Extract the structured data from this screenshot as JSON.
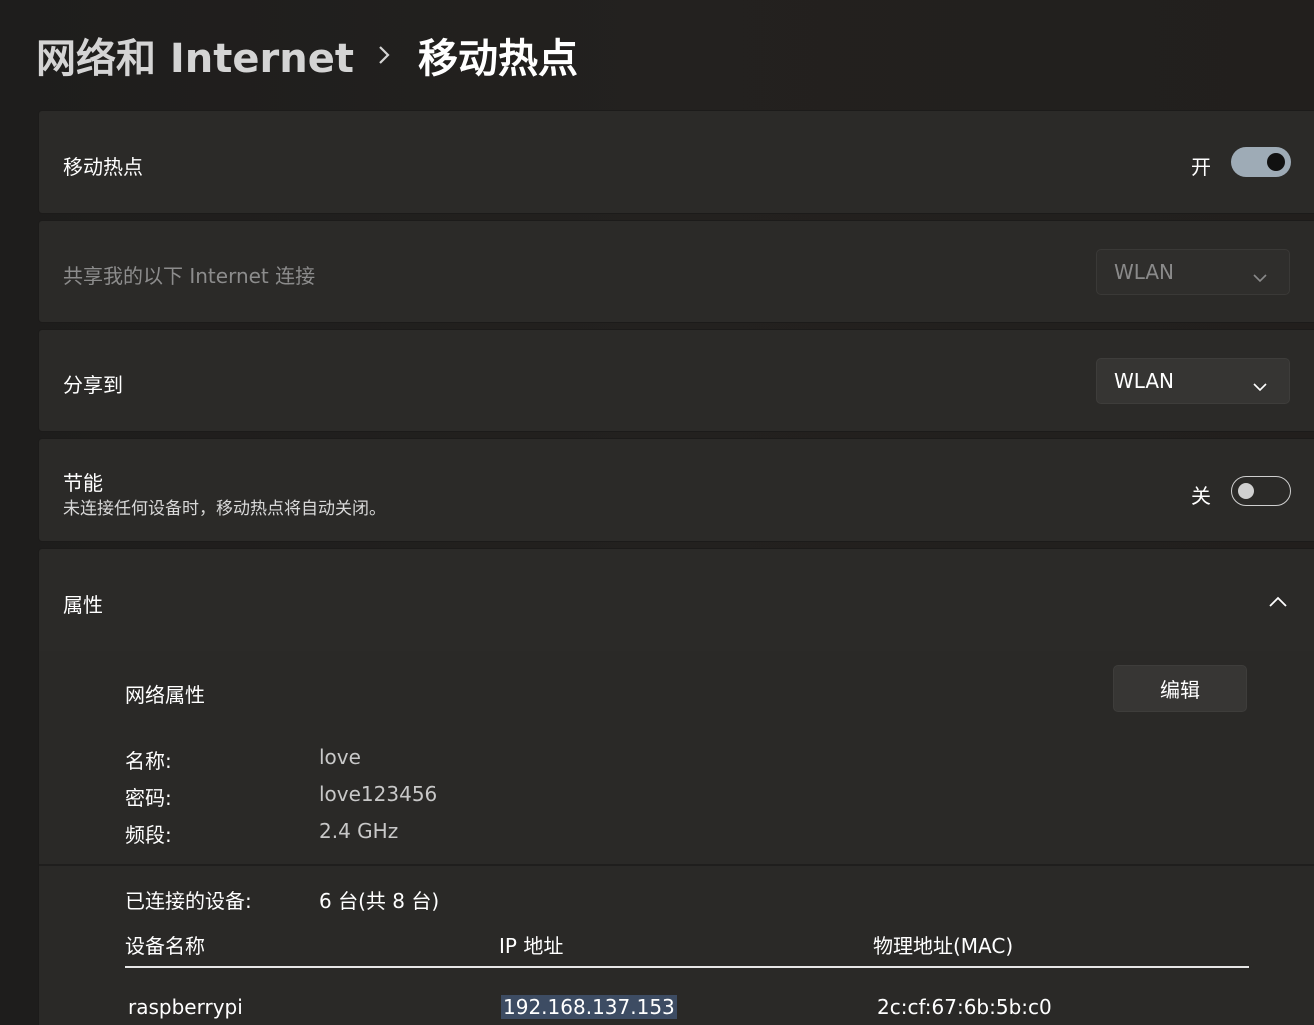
{
  "breadcrumb": {
    "parent": "网络和 Internet",
    "current": "移动热点"
  },
  "hotspot": {
    "label": "移动热点",
    "state_label": "开",
    "enabled": true
  },
  "share_from": {
    "label": "共享我的以下 Internet 连接",
    "value": "WLAN",
    "disabled": true
  },
  "share_over": {
    "label": "分享到",
    "value": "WLAN"
  },
  "power_saving": {
    "label": "节能",
    "description": "未连接任何设备时，移动热点将自动关闭。",
    "state_label": "关",
    "enabled": false
  },
  "properties": {
    "label": "属性",
    "expanded": true,
    "network_section_title": "网络属性",
    "edit_label": "编辑",
    "fields": [
      {
        "key": "名称:",
        "value": "love"
      },
      {
        "key": "密码:",
        "value": "love123456"
      },
      {
        "key": "频段:",
        "value": "2.4 GHz"
      }
    ],
    "connected_label": "已连接的设备:",
    "connected_value": "6 台(共 8 台)",
    "table": {
      "headers": [
        "设备名称",
        "IP 地址",
        "物理地址(MAC)"
      ],
      "rows": [
        [
          "raspberrypi",
          "192.168.137.153",
          "2c:cf:67:6b:5b:c0"
        ]
      ]
    }
  },
  "colors": {
    "toggle_on": "#9eabb6",
    "selection": "#3d4c63",
    "card_bg": "#2b2a28"
  },
  "icons": {
    "chevron_right": "chevron-right-icon",
    "chevron_down": "chevron-down-icon",
    "chevron_up": "chevron-up-icon"
  }
}
